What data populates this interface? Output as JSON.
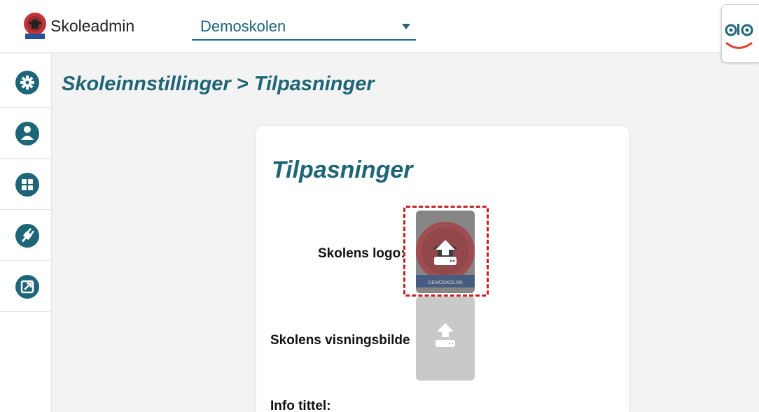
{
  "app": {
    "title": "Skoleadmin",
    "logo_icon": "school-badge-icon",
    "logo_text": "DEMOSKOLAN"
  },
  "school_select": {
    "value": "Demoskolen",
    "icon": "caret-down-icon"
  },
  "brand_badge": {
    "icon": "olo-face-icon",
    "text": "OLO"
  },
  "sidebar": {
    "items": [
      {
        "key": "settings",
        "icon": "gear-icon"
      },
      {
        "key": "users",
        "icon": "user-icon"
      },
      {
        "key": "apps",
        "icon": "grid-icon"
      },
      {
        "key": "integrations",
        "icon": "plug-icon"
      },
      {
        "key": "external",
        "icon": "external-link-icon"
      }
    ]
  },
  "page": {
    "breadcrumb": "Skoleinnstillinger > Tilpasninger"
  },
  "card": {
    "title": "Tilpasninger",
    "logo_label": "Skolens logo:",
    "logo_image_text": "DEMOSKOLAN",
    "display_image_label": "Skolens visningsbilde",
    "info_title_label": "Info tittel:"
  },
  "colors": {
    "accent": "#1d6577",
    "highlight_border": "#c51f24",
    "logo_red": "#c0343a",
    "upload_placeholder": "#c9c9c9"
  }
}
